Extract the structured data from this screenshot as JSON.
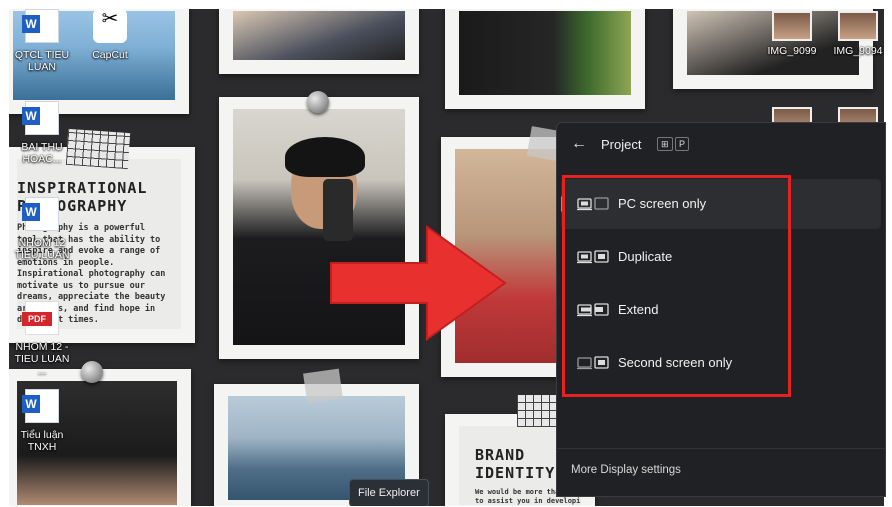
{
  "desktop": {
    "icons": [
      {
        "name": "doc-qtcl",
        "label": "QTCL TIEU LUAN",
        "type": "word"
      },
      {
        "name": "capcut",
        "label": "CapCut",
        "type": "capcut"
      },
      {
        "name": "doc-bai-thu",
        "label": "BAI THU HOAC...",
        "type": "word"
      },
      {
        "name": "doc-nhom12",
        "label": "NHOM 12 TIEU LUAN",
        "type": "word"
      },
      {
        "name": "pdf-nhom12",
        "label": "NHOM 12 - TIEU LUAN ...",
        "type": "pdf"
      },
      {
        "name": "doc-tieu-luan",
        "label": "Tiểu luận TNXH",
        "type": "word"
      },
      {
        "name": "img-9099",
        "label": "IMG_9099",
        "type": "image"
      },
      {
        "name": "img-9094",
        "label": "IMG_9094",
        "type": "image"
      }
    ],
    "wallpaper": {
      "poster1_title": "INSPIRATIONAL\nPHOTOGRAPHY",
      "poster1_body": "Photography is a powerful tool that has the ability to inspire and evoke a range of emotions in people. Inspirational photography can motivate us to pursue our dreams, appreciate the beauty around us, and find hope in difficult times.",
      "poster2_title": "BRAND\nIDENTITY",
      "poster2_body": "We would be more than happy to assist you in developing a unique brand identity for"
    },
    "tooltip": "File Explorer"
  },
  "project_panel": {
    "title": "Project",
    "shortcut_keys": [
      "⊞",
      "P"
    ],
    "options": [
      {
        "name": "pc-screen-only",
        "label": "PC screen only",
        "selected": true
      },
      {
        "name": "duplicate",
        "label": "Duplicate",
        "selected": false
      },
      {
        "name": "extend",
        "label": "Extend",
        "selected": false
      },
      {
        "name": "second-screen-only",
        "label": "Second screen only",
        "selected": false
      }
    ],
    "footer_link": "More Display settings"
  },
  "colors": {
    "highlight": "#e42222",
    "arrow": "#e8312f",
    "selection_bar": "#4ca7ff",
    "flyout_bg": "#202124"
  }
}
